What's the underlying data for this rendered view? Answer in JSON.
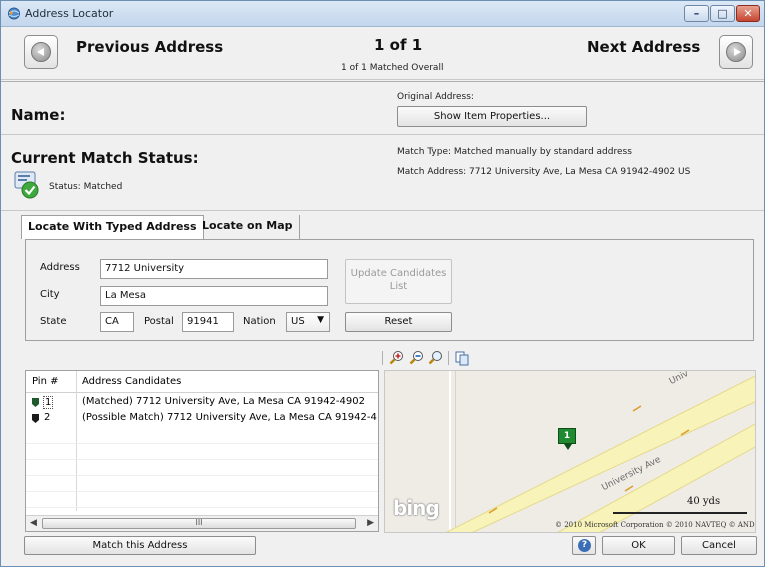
{
  "window": {
    "title": "Address Locator"
  },
  "nav": {
    "prev_label": "Previous Address",
    "next_label": "Next Address",
    "counter": "1 of 1",
    "counter_sub": "1 of 1 Matched Overall"
  },
  "name_section": {
    "label": "Name:",
    "original_address_label": "Original Address:",
    "show_props_button": "Show Item Properties..."
  },
  "status_section": {
    "label": "Current Match Status:",
    "status_text": "Status: Matched",
    "match_type": "Match Type: Matched manually by standard address",
    "match_address": "Match Address: 7712 University Ave, La Mesa CA 91942-4902  US"
  },
  "tabs": [
    {
      "label": "Locate With Typed Address",
      "active": true
    },
    {
      "label": "Locate on Map",
      "active": false
    }
  ],
  "form": {
    "address_label": "Address",
    "address_value": "7712 University",
    "city_label": "City",
    "city_value": "La Mesa",
    "state_label": "State",
    "state_value": "CA",
    "postal_label": "Postal",
    "postal_value": "91941",
    "nation_label": "Nation",
    "nation_value": "US",
    "update_button": "Update Candidates List",
    "reset_button": "Reset"
  },
  "candidates": {
    "headers": [
      "Pin #",
      "Address Candidates"
    ],
    "rows": [
      {
        "pin": "1",
        "text": "(Matched) 7712 University Ave, La Mesa CA 91942-4902",
        "color": "#1f5a2e"
      },
      {
        "pin": "2",
        "text": "(Possible Match) 7712 University Ave, La Mesa CA 91942-4",
        "color": "#1a1a1a"
      }
    ],
    "scroll_thumb": "III"
  },
  "map": {
    "road_label_1": "Univ",
    "road_label_2": "University Ave",
    "pin_label": "1",
    "logo": "bing",
    "scale": "40 yds",
    "copyright": "© 2010 Microsoft Corporation  © 2010 NAVTEQ  © AND"
  },
  "footer": {
    "match_button": "Match this Address",
    "help_icon": "?",
    "ok_button": "OK",
    "cancel_button": "Cancel"
  },
  "colors": {
    "window_bg": "#f0f0f0",
    "map_bg": "#efece6",
    "road": "#f8f3b8",
    "pin_green": "#1f8a2f",
    "accent_blue": "#3a6fb7"
  }
}
